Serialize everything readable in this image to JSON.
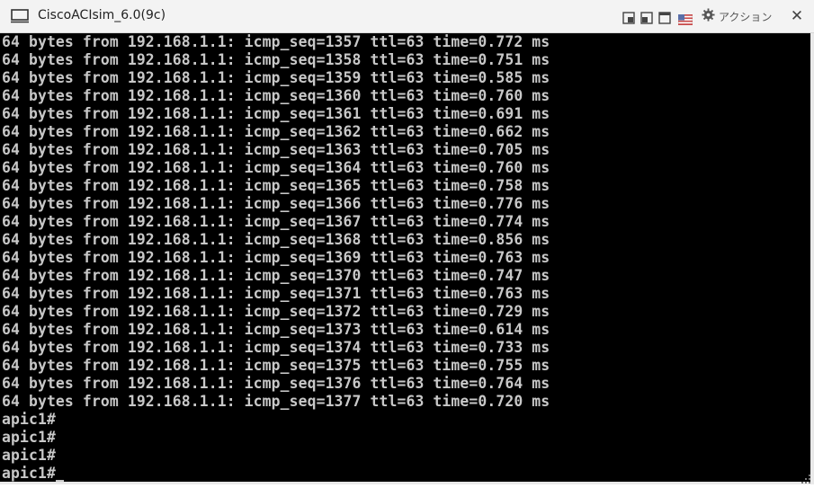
{
  "window": {
    "title": "CiscoACIsim_6.0(9c)",
    "actions_label": "アクション"
  },
  "toolbar_icons": [
    "fit-window-icon",
    "restore-window-icon",
    "maximize-window-icon",
    "us-keyboard-flag-icon",
    "gear-icon",
    "close-icon"
  ],
  "colors": {
    "console_bg": "#000000",
    "console_text": "#c8c8c8",
    "titlebar_bg": "#f3f3f3"
  },
  "console": {
    "lines": [
      "64 bytes from 192.168.1.1: icmp_seq=1357 ttl=63 time=0.772 ms",
      "64 bytes from 192.168.1.1: icmp_seq=1358 ttl=63 time=0.751 ms",
      "64 bytes from 192.168.1.1: icmp_seq=1359 ttl=63 time=0.585 ms",
      "64 bytes from 192.168.1.1: icmp_seq=1360 ttl=63 time=0.760 ms",
      "64 bytes from 192.168.1.1: icmp_seq=1361 ttl=63 time=0.691 ms",
      "64 bytes from 192.168.1.1: icmp_seq=1362 ttl=63 time=0.662 ms",
      "64 bytes from 192.168.1.1: icmp_seq=1363 ttl=63 time=0.705 ms",
      "64 bytes from 192.168.1.1: icmp_seq=1364 ttl=63 time=0.760 ms",
      "64 bytes from 192.168.1.1: icmp_seq=1365 ttl=63 time=0.758 ms",
      "64 bytes from 192.168.1.1: icmp_seq=1366 ttl=63 time=0.776 ms",
      "64 bytes from 192.168.1.1: icmp_seq=1367 ttl=63 time=0.774 ms",
      "64 bytes from 192.168.1.1: icmp_seq=1368 ttl=63 time=0.856 ms",
      "64 bytes from 192.168.1.1: icmp_seq=1369 ttl=63 time=0.763 ms",
      "64 bytes from 192.168.1.1: icmp_seq=1370 ttl=63 time=0.747 ms",
      "64 bytes from 192.168.1.1: icmp_seq=1371 ttl=63 time=0.763 ms",
      "64 bytes from 192.168.1.1: icmp_seq=1372 ttl=63 time=0.729 ms",
      "64 bytes from 192.168.1.1: icmp_seq=1373 ttl=63 time=0.614 ms",
      "64 bytes from 192.168.1.1: icmp_seq=1374 ttl=63 time=0.733 ms",
      "64 bytes from 192.168.1.1: icmp_seq=1375 ttl=63 time=0.755 ms",
      "64 bytes from 192.168.1.1: icmp_seq=1376 ttl=63 time=0.764 ms",
      "64 bytes from 192.168.1.1: icmp_seq=1377 ttl=63 time=0.720 ms",
      "apic1#",
      "apic1#",
      "apic1#",
      "apic1#"
    ]
  }
}
